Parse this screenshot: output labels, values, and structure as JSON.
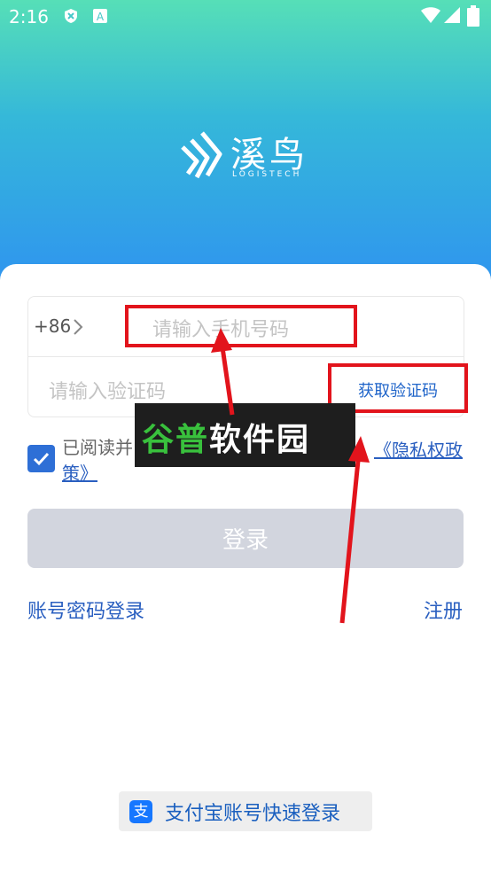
{
  "status_bar": {
    "time": "2:16",
    "icons": [
      "shield-x-icon",
      "a-icon",
      "wifi-icon",
      "signal-icon",
      "battery-icon"
    ]
  },
  "brand": {
    "name": "溪鸟",
    "subtitle": "LOGISTECH"
  },
  "form": {
    "country_code": "+86",
    "phone_placeholder": "请输入手机号码",
    "code_placeholder": "请输入验证码",
    "get_code_label": "获取验证码"
  },
  "agreement": {
    "checked": true,
    "text": "已阅读并",
    "policy_link_part1": "《隐私权政",
    "policy_link_part2": "策》"
  },
  "login_button": "登录",
  "password_login_link": "账号密码登录",
  "register_link": "注册",
  "alipay": {
    "icon_char": "支",
    "label": "支付宝账号快速登录"
  },
  "watermark": {
    "text_part1": "谷普",
    "text_part2": "软件园"
  },
  "colors": {
    "accent": "#2e6fd6",
    "link": "#2a5fc0",
    "annotation_red": "#e2141c",
    "login_disabled": "#d2d5de"
  }
}
